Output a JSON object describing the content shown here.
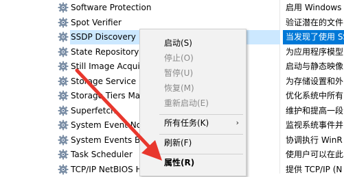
{
  "services": [
    {
      "name": "Software Protection",
      "desc": "启用 Windows"
    },
    {
      "name": "Spot Verifier",
      "desc": "验证潜在的文件"
    },
    {
      "name": "SSDP Discovery",
      "desc": "当发现了使用 SS"
    },
    {
      "name": "State Repository S",
      "desc": "为应用程序模型"
    },
    {
      "name": "Still Image Acquis",
      "desc": "启动与静态映像"
    },
    {
      "name": "Storage Service",
      "desc": "为存储设置和外"
    },
    {
      "name": "Storage Tiers Ma",
      "desc": "优化系统中所有"
    },
    {
      "name": "Superfetch",
      "desc": "维护和提高一段"
    },
    {
      "name": "System Event Not",
      "desc": "监视系统事件并"
    },
    {
      "name": "System Events Bro",
      "desc": "协调执行 WinR"
    },
    {
      "name": "Task Scheduler",
      "desc": "使用户可以在此"
    },
    {
      "name": "TCP/IP NetBIOS H",
      "desc": "提供 TCP/IP (N"
    }
  ],
  "context_menu": {
    "start": "启动(S)",
    "stop": "停止(O)",
    "pause": "暂停(U)",
    "resume": "恢复(M)",
    "restart": "重新启动(E)",
    "all_tasks": "所有任务(K)",
    "all_tasks_arrow": "›",
    "refresh": "刷新(F)",
    "properties": "属性(R)"
  },
  "colors": {
    "selection_name_bg": "#cce8ff",
    "selection_desc_bg": "#0078d7",
    "annotation_arrow": "#e8372d"
  },
  "icons": {
    "service": "gear-icon",
    "annotation": "red-arrow-icon"
  }
}
